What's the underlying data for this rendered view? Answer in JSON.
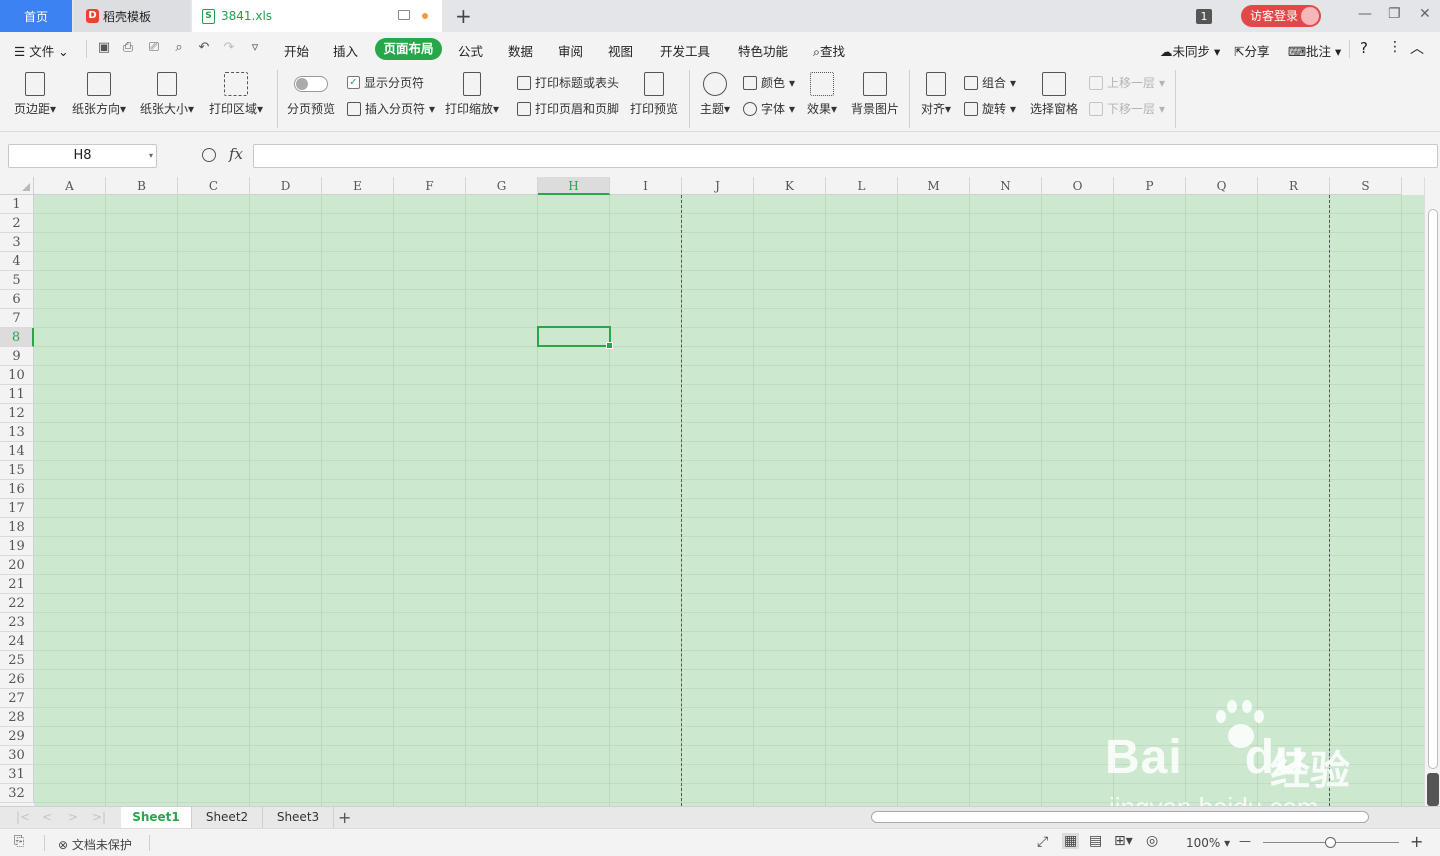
{
  "tabs": {
    "home": "首页",
    "template": "稻壳模板",
    "doc": "3841.xls",
    "doc_icon": "S",
    "new_tab": "+"
  },
  "titlebar": {
    "window_count": "1",
    "login": "访客登录",
    "minimize": "—",
    "restore": "❐",
    "close": "✕"
  },
  "menu": {
    "file": "文件",
    "items": [
      "开始",
      "插入",
      "页面布局",
      "公式",
      "数据",
      "审阅",
      "视图",
      "开发工具",
      "特色功能"
    ],
    "active": "页面布局",
    "search": "查找",
    "sync": "未同步",
    "share": "分享",
    "comment": "批注",
    "help": "?",
    "more": "⋮",
    "collapse": "︿"
  },
  "ribbon": {
    "margins": "页边距",
    "orientation": "纸张方向",
    "size": "纸张大小",
    "print_area": "打印区域",
    "page_break_preview": "分页预览",
    "show_page_breaks": "显示分页符",
    "insert_page_break": "插入分页符",
    "print_scale": "打印缩放",
    "print_titles": "打印标题或表头",
    "header_footer": "打印页眉和页脚",
    "print_preview": "打印预览",
    "theme": "主题",
    "colors": "颜色",
    "fonts": "字体",
    "effects": "效果",
    "background": "背景图片",
    "align": "对齐",
    "group": "组合",
    "rotate": "旋转",
    "selection_pane": "选择窗格",
    "bring_forward": "上移一层",
    "send_backward": "下移一层"
  },
  "formula_bar": {
    "name_box": "H8",
    "fx": "fx",
    "formula": ""
  },
  "grid": {
    "columns": [
      "A",
      "B",
      "C",
      "D",
      "E",
      "F",
      "G",
      "H",
      "I",
      "J",
      "K",
      "L",
      "M",
      "N",
      "O",
      "P",
      "Q",
      "R",
      "S"
    ],
    "rows": [
      "1",
      "2",
      "3",
      "4",
      "5",
      "6",
      "7",
      "8",
      "9",
      "10",
      "11",
      "12",
      "13",
      "14",
      "15",
      "16",
      "17",
      "18",
      "19",
      "20",
      "21",
      "22",
      "23",
      "24",
      "25",
      "26",
      "27",
      "28",
      "29",
      "30",
      "31",
      "32"
    ],
    "selected_column": "H",
    "selected_row": "8",
    "cell_color": "#cce8cf"
  },
  "sheets": {
    "names": [
      "Sheet1",
      "Sheet2",
      "Sheet3"
    ],
    "active": "Sheet1",
    "add": "+"
  },
  "status": {
    "protect": "文档未保护",
    "zoom": "100%",
    "zoom_out": "—",
    "zoom_in": "+"
  },
  "watermark": {
    "brand": "Bai",
    "brand2": "du",
    "cn": "经验",
    "url": "jingyan.baidu.com"
  },
  "colors": {
    "accent": "#27a74a",
    "home_tab": "#3c82f0",
    "login": "#e34848"
  }
}
